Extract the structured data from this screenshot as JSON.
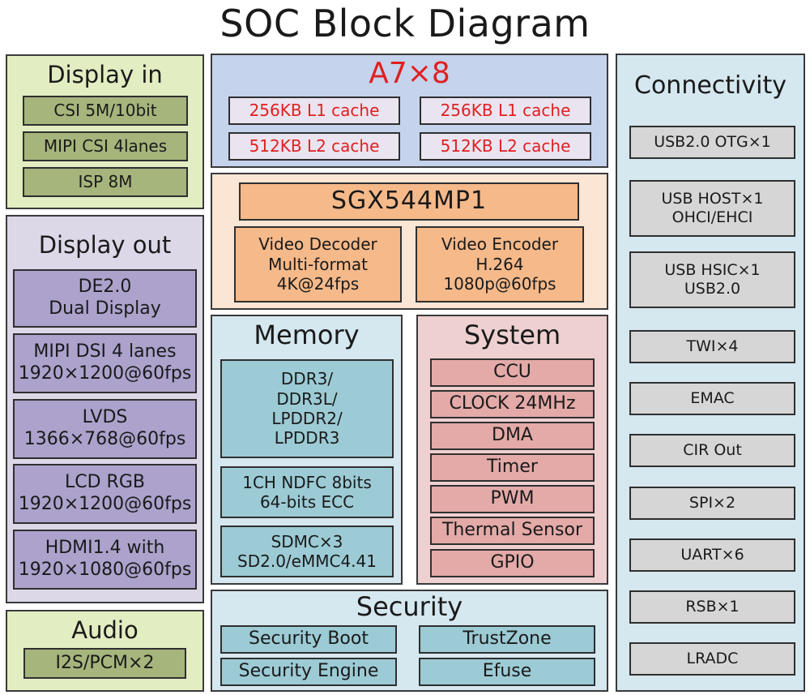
{
  "title": "SOC Block Diagram",
  "colors": {
    "cpu_text": "#e02020",
    "display_in_bg": "#e2edc2",
    "display_out_bg": "#dcd8e8",
    "cpu_bg": "#c5d3ec",
    "gpu_bg": "#fbe5d4",
    "memory_bg": "#d5e7ef",
    "system_bg": "#eed0d0",
    "connectivity_bg": "#d5e7ef"
  },
  "display_in": {
    "title": "Display in",
    "items": [
      "CSI  5M/10bit",
      "MIPI CSI 4lanes",
      "ISP 8M"
    ]
  },
  "display_out": {
    "title": "Display out",
    "items": [
      "DE2.0\nDual Display",
      "MIPI DSI 4 lanes\n1920×1200@60fps",
      "LVDS\n1366×768@60fps",
      "LCD RGB\n1920×1200@60fps",
      "HDMI1.4 with\n1920×1080@60fps"
    ]
  },
  "audio": {
    "title": "Audio",
    "items": [
      "I2S/PCM×2"
    ]
  },
  "cpu": {
    "title": "A7×8",
    "items": [
      "256KB L1 cache",
      "256KB L1 cache",
      "512KB L2 cache",
      "512KB L2 cache"
    ]
  },
  "gpu": {
    "title": "SGX544MP1",
    "items": [
      "Video Decoder\nMulti-format\n4K@24fps",
      "Video Encoder\nH.264\n1080p@60fps"
    ]
  },
  "memory": {
    "title": "Memory",
    "items": [
      "DDR3/\nDDR3L/\nLPDDR2/\nLPDDR3",
      "1CH NDFC 8bits\n64-bits ECC",
      "SDMC×3\nSD2.0/eMMC4.41"
    ]
  },
  "system": {
    "title": "System",
    "items": [
      "CCU",
      "CLOCK 24MHz",
      "DMA",
      "Timer",
      "PWM",
      "Thermal Sensor",
      "GPIO"
    ]
  },
  "security": {
    "title": "Security",
    "items": [
      "Security Boot",
      "TrustZone",
      "Security Engine",
      "Efuse"
    ]
  },
  "connectivity": {
    "title": "Connectivity",
    "items": [
      "USB2.0 OTG×1",
      "USB HOST×1\nOHCI/EHCI",
      "USB HSIC×1\nUSB2.0",
      "TWI×4",
      "EMAC",
      "CIR Out",
      "SPI×2",
      "UART×6",
      "RSB×1",
      "LRADC"
    ]
  }
}
